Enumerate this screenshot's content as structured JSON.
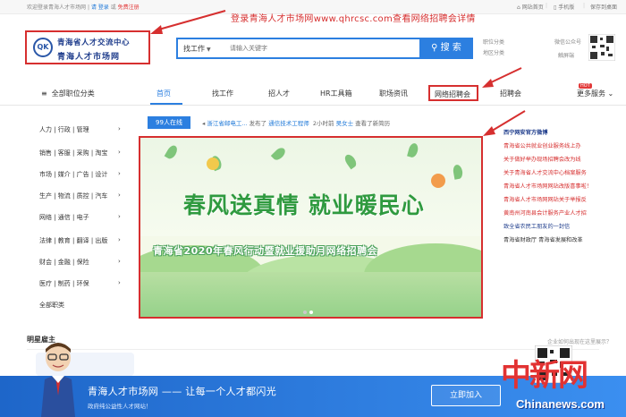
{
  "topbar": {
    "welcome": "欢迎登录青海人才市场网",
    "sep": "|",
    "login": "请 登录",
    "or": "或",
    "register": "免费注册",
    "right_items": [
      "网站首页",
      "|",
      "手机版",
      "|",
      "保存到桌面"
    ]
  },
  "annotation": {
    "text": "登录青海人才市场网www.qhrcsc.com查看网络招聘会详情"
  },
  "logo": {
    "line1": "青海省人才交流中心",
    "line2": "青海人才市场网",
    "mark": "QK"
  },
  "search": {
    "select_label": "找工作",
    "placeholder": "请输入关键字",
    "button_label": "搜 索",
    "side_links": [
      "职位分类",
      "地区分类"
    ],
    "wechat": [
      "微信公众号",
      "触屏端"
    ]
  },
  "nav": {
    "all_categories": "全部职位分类",
    "items": [
      "首页",
      "找工作",
      "招人才",
      "HR工具箱",
      "职场资讯",
      "网络招聘会",
      "招聘会"
    ],
    "more": "更多服务",
    "hot": "HOT"
  },
  "categories": [
    "人力 | 行政 | 管理",
    "销售 | 客服 | 采购 | 淘宝",
    "市场 | 媒介 | 广告 | 设计",
    "生产 | 物流 | 质控 | 汽车",
    "网络 | 通信 | 电子",
    "法律 | 教育 | 翻译 | 出版",
    "财会 | 金融 | 保险",
    "医疗 | 制药 | 环保",
    "全部职类"
  ],
  "ticker": {
    "online": "99人在线",
    "company": "浙江省邮电工...",
    "posted": "发布了",
    "job": "通信技术工程师",
    "time": "2小时前",
    "user": "吴女士",
    "action": "查看了新简历"
  },
  "banner": {
    "title": "春风送真情 就业暖民心",
    "subtitle": "青海省2020年春风行动暨就业援助月网络招聘会"
  },
  "news": {
    "heading": "西宁网安官方微博",
    "items": [
      "青海省公共就业创业服务线上办",
      "关于做好举办现场招聘会改为线",
      "关于青海省人才交流中心档案服务",
      "青海省人才市场网网站改版喜事啦！",
      "青海省人才市场网网站关于举报反",
      "黄南州河南县会计服务产业人才招",
      "致全省农民工朋友的一封信",
      "青海省财政厅  青海省发展和改革"
    ]
  },
  "stars": {
    "title": "明星雇主",
    "fav": "企业如何出现在这里展示？"
  },
  "bottom": {
    "title": "青海人才市场网 —— 让每一个人才都闪光",
    "subtitle": "政府纯公益性人才网站！",
    "join": "立即加入"
  },
  "watermark": {
    "cn": "中新网",
    "en": "Chinanews.com"
  },
  "colors": {
    "accent": "#2c7fe0",
    "annotation_red": "#d62f2f",
    "banner_green": "#2f9a3f"
  }
}
